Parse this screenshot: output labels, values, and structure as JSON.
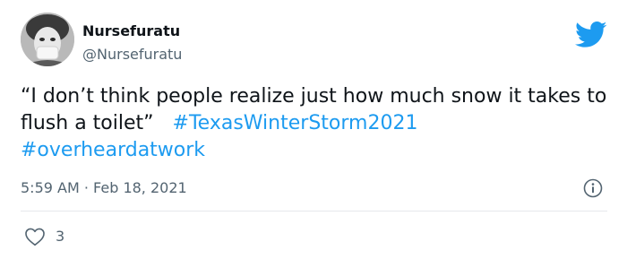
{
  "user": {
    "display_name": "Nursefuratu",
    "handle": "@Nursefuratu"
  },
  "tweet": {
    "text": "“I don’t think people realize just how much snow it takes to flush a toilet”",
    "hashtags": [
      "#TexasWinterStorm2021",
      "#overheardatwork"
    ],
    "timestamp": "5:59 AM · Feb 18, 2021"
  },
  "engagement": {
    "likes": "3"
  },
  "icons": {
    "brand": "twitter-bird-icon",
    "info": "info-icon",
    "like": "heart-icon"
  },
  "colors": {
    "brand": "#1d9bf0",
    "secondary_text": "#536471",
    "primary_text": "#0f1419"
  }
}
